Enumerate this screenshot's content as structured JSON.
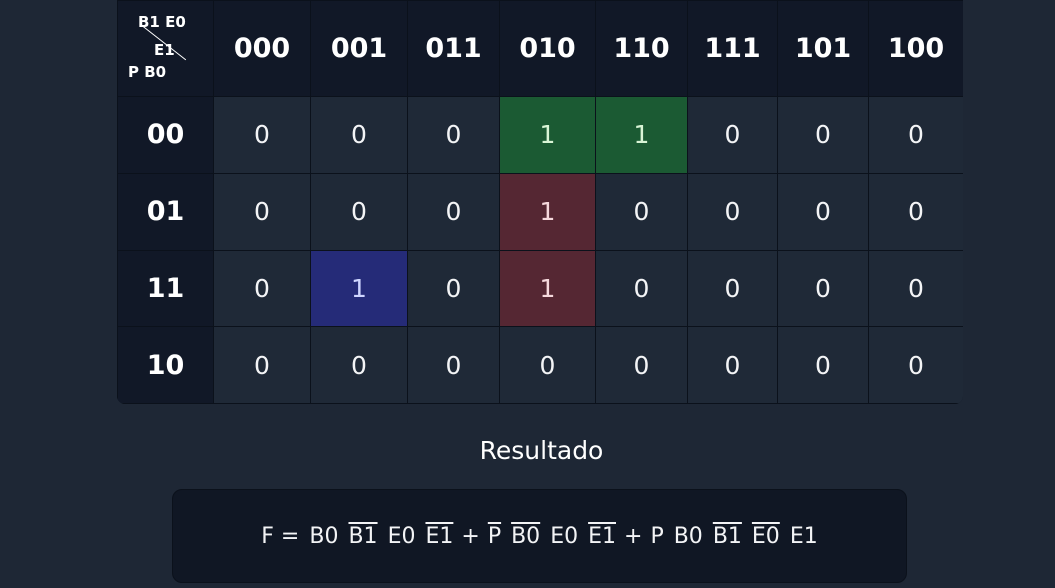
{
  "kmap": {
    "corner": {
      "top": "B1 E0",
      "mid": "E1",
      "bottom": "P B0"
    },
    "columns": [
      "000",
      "001",
      "011",
      "010",
      "110",
      "111",
      "101",
      "100"
    ],
    "rows": [
      {
        "label": "00",
        "cells": [
          "0",
          "0",
          "0",
          "1",
          "1",
          "0",
          "0",
          "0"
        ]
      },
      {
        "label": "01",
        "cells": [
          "0",
          "0",
          "0",
          "1",
          "0",
          "0",
          "0",
          "0"
        ]
      },
      {
        "label": "11",
        "cells": [
          "0",
          "1",
          "0",
          "1",
          "0",
          "0",
          "0",
          "0"
        ]
      },
      {
        "label": "10",
        "cells": [
          "0",
          "0",
          "0",
          "0",
          "0",
          "0",
          "0",
          "0"
        ]
      }
    ],
    "group_colors": {
      "green": "#1b5a33",
      "red": "#552733",
      "blue": "#252b78"
    }
  },
  "result": {
    "title": "Resultado",
    "formula": {
      "lhs": "F =",
      "terms": [
        [
          {
            "v": "B0",
            "neg": false
          },
          {
            "v": "B1",
            "neg": true
          },
          {
            "v": "E0",
            "neg": false
          },
          {
            "v": "E1",
            "neg": true
          }
        ],
        [
          {
            "v": "P",
            "neg": true
          },
          {
            "v": "B0",
            "neg": true
          },
          {
            "v": "E0",
            "neg": false
          },
          {
            "v": "E1",
            "neg": true
          }
        ],
        [
          {
            "v": "P",
            "neg": false
          },
          {
            "v": "B0",
            "neg": false
          },
          {
            "v": "B1",
            "neg": true
          },
          {
            "v": "E0",
            "neg": true
          },
          {
            "v": "E1",
            "neg": false
          }
        ]
      ],
      "plus": "+"
    }
  }
}
